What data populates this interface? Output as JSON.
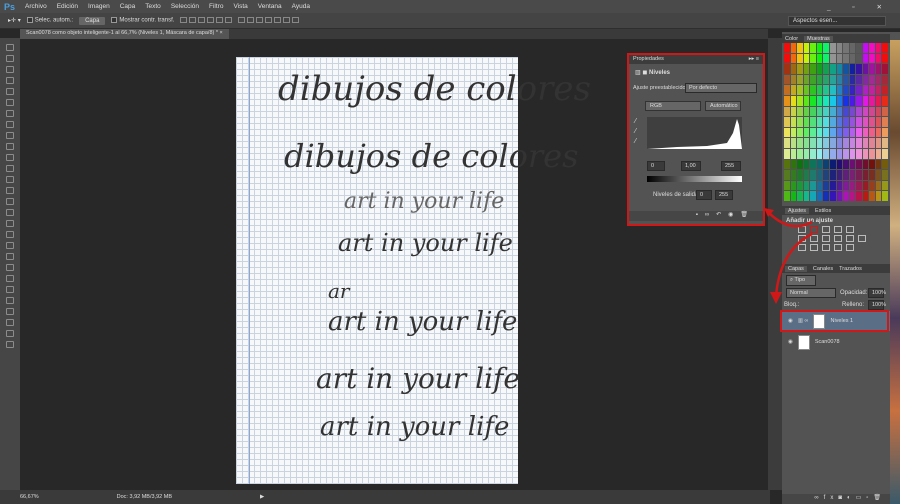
{
  "app": {
    "logo": "Ps",
    "menu": [
      "Archivo",
      "Edición",
      "Imagen",
      "Capa",
      "Texto",
      "Selección",
      "Filtro",
      "Vista",
      "Ventana",
      "Ayuda"
    ],
    "workspace": "Aspectos esen..."
  },
  "options": {
    "auto_select": "Selec. autom.:",
    "auto_select_target": "Capa",
    "show_transform": "Mostrar contr. transf."
  },
  "document": {
    "tab": "Scan0078 como objeto inteligente-1 al 66,7% (Niveles 1, Máscara de capa/8) *",
    "close": "×"
  },
  "artwork": {
    "lines": [
      "dibujos de colores",
      "dibujos de colores",
      "art in your life",
      "art in your life",
      "ar",
      "art in your life",
      "art in your life",
      "art in your life"
    ]
  },
  "status": {
    "zoom": "66,67%",
    "doc": "Doc: 3,92 MB/3,92 MB"
  },
  "properties": {
    "title": "Propiedades",
    "type": "Niveles",
    "preset_label": "Ajuste preestablecido:",
    "preset_value": "Por defecto",
    "channel": "RGB",
    "auto": "Automático",
    "input_black": "0",
    "input_mid": "1,00",
    "input_white": "255",
    "output_label": "Niveles de salida:",
    "output_black": "0",
    "output_white": "255"
  },
  "panels": {
    "color_tab": "Color",
    "swatches_tab": "Muestras",
    "adjust_tab": "Ajustes",
    "styles_tab": "Estilos",
    "add_adjust": "Añadir un ajuste",
    "layers_tab": "Capas",
    "channels_tab": "Canales",
    "paths_tab": "Trazados",
    "filter_kind": "Tipo",
    "blend": "Normal",
    "opacity_label": "Opacidad:",
    "opacity": "100%",
    "lock_label": "Bloq.:",
    "fill_label": "Relleno:",
    "fill": "100%"
  },
  "layers": [
    {
      "name": "Niveles 1",
      "selected": true
    },
    {
      "name": "Scan0078",
      "selected": false
    }
  ],
  "accent": "#d01818"
}
